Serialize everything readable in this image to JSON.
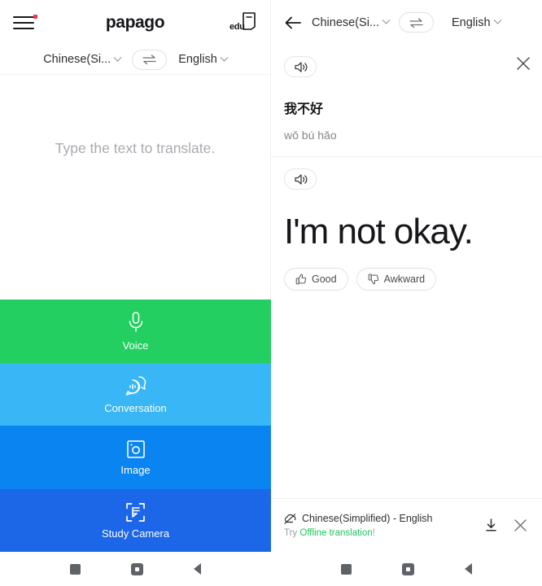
{
  "left": {
    "app_bar": {
      "menu_icon": "hamburger-menu-icon",
      "has_notification_dot": true,
      "brand": "papago",
      "edu_label": "edu"
    },
    "lang_bar": {
      "source_lang": "Chinese(Si...",
      "swap_icon": "swap-arrows-icon",
      "target_lang": "English"
    },
    "input": {
      "placeholder": "Type the text to translate."
    },
    "tiles": [
      {
        "label": "Voice",
        "icon": "microphone-icon",
        "color": "#22cf60"
      },
      {
        "label": "Conversation",
        "icon": "chat-bubbles-icon",
        "color": "#38b6f5"
      },
      {
        "label": "Image",
        "icon": "photo-icon",
        "color": "#0a84f0"
      },
      {
        "label": "Study Camera",
        "icon": "document-scan-icon",
        "color": "#1c66e8"
      }
    ]
  },
  "right": {
    "app_bar": {
      "back_icon": "back-arrow-icon",
      "source_lang": "Chinese(Si...",
      "swap_icon": "swap-arrows-icon",
      "target_lang": "English"
    },
    "source": {
      "speak_icon": "speaker-icon",
      "close_icon": "close-icon",
      "text": "我不好",
      "romanization": "wǒ bú hǎo"
    },
    "target": {
      "speak_icon": "speaker-icon",
      "text": "I'm not okay.",
      "feedback": [
        {
          "label": "Good",
          "icon": "thumbs-up-icon"
        },
        {
          "label": "Awkward",
          "icon": "thumbs-down-icon"
        }
      ]
    },
    "offline": {
      "cloud_icon": "cloud-off-icon",
      "pair": "Chinese(Simplified) - English",
      "prefix": "Try ",
      "link": "Offline translation",
      "suffix": "!",
      "download_icon": "download-icon",
      "close_icon": "close-icon",
      "link_color": "#1ec55f"
    }
  },
  "navbar": {
    "recents": "recents-square-icon",
    "home": "home-circle-icon",
    "back": "back-triangle-icon"
  }
}
